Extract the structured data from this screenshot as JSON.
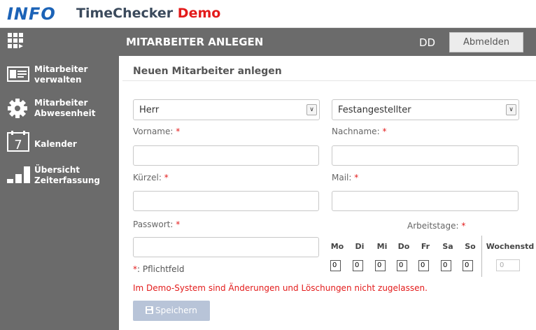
{
  "app": {
    "logo_text": "INFO",
    "title_main": "TimeChecker",
    "title_demo": "Demo"
  },
  "colors": {
    "header_bar": "#6b6b6b",
    "demo_red": "#e31b1b",
    "logo_blue": "#1c63b7",
    "save_button": "#b8c4d8"
  },
  "sidebar": {
    "items": [
      {
        "label": "Mitarbeiter\nverwalten",
        "icon": "id-card-icon"
      },
      {
        "label": "Mitarbeiter\nAbwesenheit",
        "icon": "gear-icon"
      },
      {
        "label": "Kalender",
        "icon": "calendar-icon",
        "icon_text": "7"
      },
      {
        "label": "Übersicht\nZeiterfassung",
        "icon": "bar-chart-icon"
      }
    ]
  },
  "topbar": {
    "title": "MITARBEITER ANLEGEN",
    "user_initials": "DD",
    "logout_label": "Abmelden"
  },
  "form": {
    "heading": "Neuen Mitarbeiter anlegen",
    "salutation_value": "Herr",
    "employment_type_value": "Festangestellter",
    "vorname_label": "Vorname:",
    "nachname_label": "Nachname:",
    "kuerzel_label": "Kürzel:",
    "mail_label": "Mail:",
    "passwort_label": "Passwort:",
    "required_mark": "*",
    "arbeitstage_label": "Arbeitstage:",
    "days": [
      "Mo",
      "Di",
      "Mi",
      "Do",
      "Fr",
      "Sa",
      "So"
    ],
    "day_values": [
      "0",
      "0",
      "0",
      "0",
      "0",
      "0",
      "0"
    ],
    "wochenstd_label": "Wochenstd",
    "wochenstd_value": "0",
    "pflichtfeld_star": "*",
    "pflichtfeld_text": ": Pflichtfeld",
    "demo_note": "Im Demo-System sind Änderungen und Löschungen nicht zugelassen.",
    "save_label": "Speichern"
  }
}
